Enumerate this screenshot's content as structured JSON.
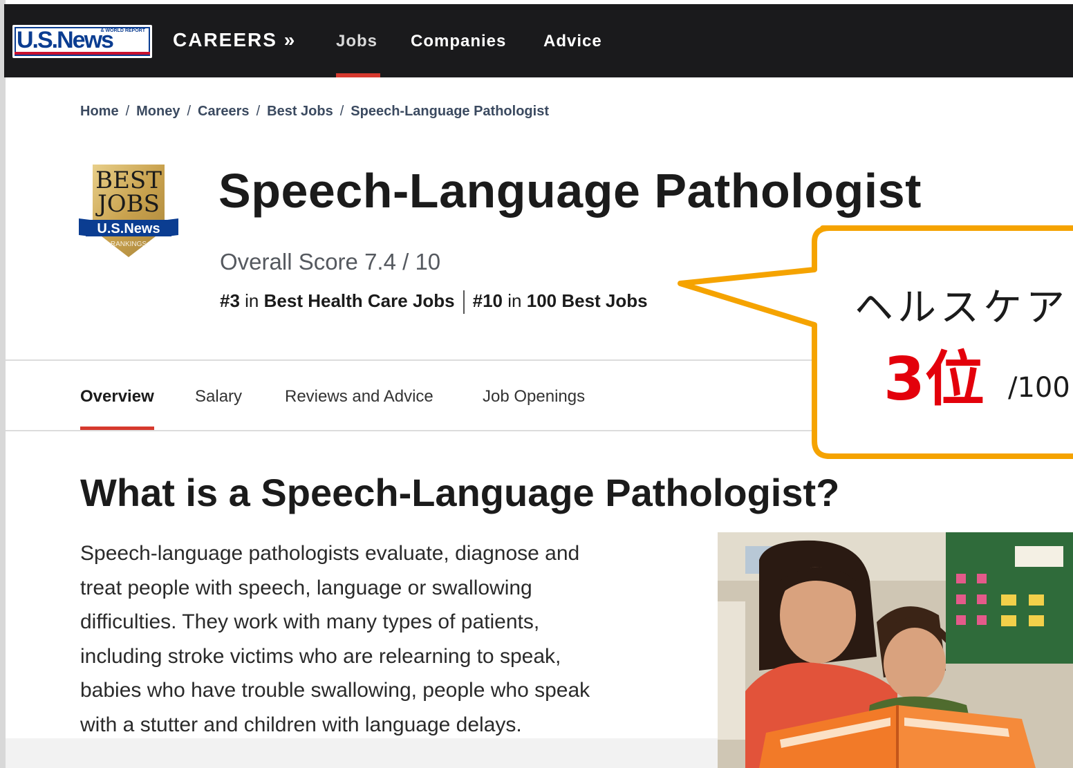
{
  "header": {
    "logo_text": "U.S.News",
    "logo_subtext": "& WORLD REPORT",
    "section": "CAREERS »",
    "nav": [
      "Jobs",
      "Companies",
      "Advice"
    ],
    "active_nav": "Jobs"
  },
  "breadcrumb": [
    "Home",
    "Money",
    "Careers",
    "Best Jobs",
    "Speech-Language Pathologist"
  ],
  "badge": {
    "line1": "BEST",
    "line2": "JOBS",
    "brand": "U.S.News",
    "ribbon": "RANKINGS"
  },
  "job": {
    "title": "Speech-Language Pathologist",
    "overall_score": "Overall Score 7.4 / 10",
    "rank1_num": "#3",
    "rank1_in": "in",
    "rank1_category": "Best Health Care Jobs",
    "rank2_num": "#10",
    "rank2_in": "in",
    "rank2_category": "100 Best Jobs"
  },
  "tabs": [
    "Overview",
    "Salary",
    "Reviews and Advice",
    "Job Openings"
  ],
  "active_tab": "Overview",
  "content": {
    "heading": "What is a Speech-Language Pathologist?",
    "lines": [
      "Speech-language pathologists evaluate, diagnose and",
      "treat people with speech, language or swallowing",
      "difficulties. They work with many types of patients,",
      "including stroke victims who are relearning to speak,",
      "babies who have trouble swallowing, people who speak",
      "with a stutter and children with language delays."
    ]
  },
  "callout": {
    "line1": "ヘルスケア",
    "rank": "3位",
    "sub": "/100"
  },
  "colors": {
    "header_bg": "#1a1a1c",
    "accent_red": "#d6392e",
    "callout_border": "#f5a300",
    "callout_rank": "#e3000b"
  }
}
